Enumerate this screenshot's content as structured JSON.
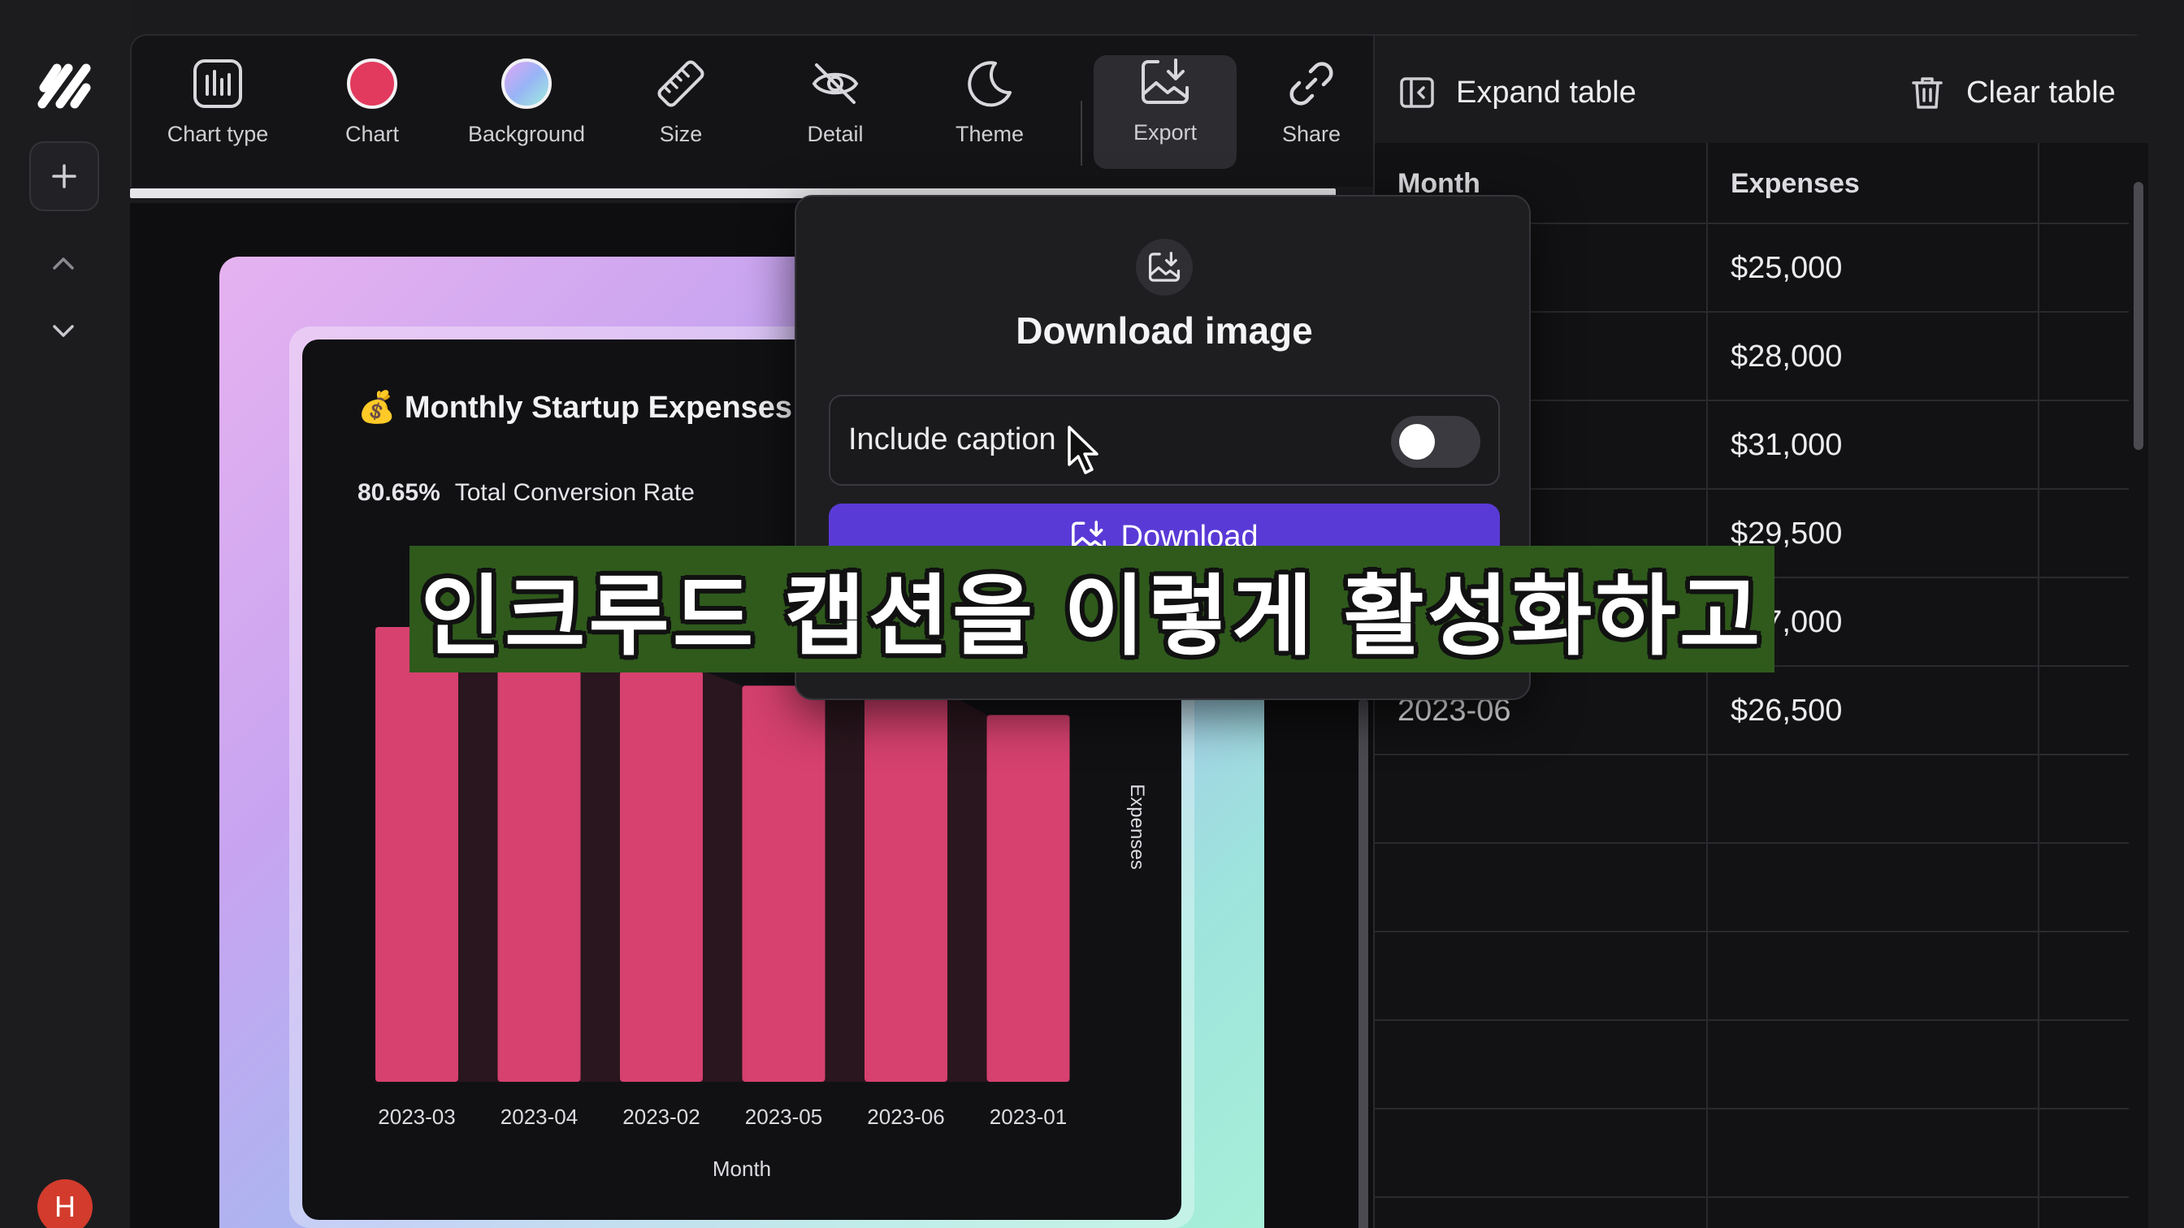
{
  "toolbar": {
    "items": [
      {
        "label": "Chart type",
        "icon": "bar-chart-icon"
      },
      {
        "label": "Chart",
        "icon": "color-dot-icon",
        "color": "#e23a5e"
      },
      {
        "label": "Background",
        "icon": "gradient-dot-icon"
      },
      {
        "label": "Size",
        "icon": "ruler-icon"
      },
      {
        "label": "Detail",
        "icon": "eye-off-icon"
      },
      {
        "label": "Theme",
        "icon": "moon-icon"
      },
      {
        "label": "Export",
        "icon": "image-download-icon",
        "active": true
      },
      {
        "label": "Share",
        "icon": "link-icon"
      }
    ]
  },
  "rail": {
    "avatar_initial": "H"
  },
  "chart_card": {
    "title": "💰 Monthly Startup Expenses",
    "kpi_value": "80.65%",
    "kpi_label": "Total Conversion Rate"
  },
  "chart_data": {
    "type": "bar",
    "categories": [
      "2023-03",
      "2023-04",
      "2023-02",
      "2023-05",
      "2023-06",
      "2023-01"
    ],
    "values": [
      31000,
      29500,
      28000,
      27000,
      26500,
      25000
    ],
    "xlabel": "Month",
    "ylabel": "Expenses",
    "bar_color": "#d6416f"
  },
  "table_panel": {
    "expand_label": "Expand table",
    "clear_label": "Clear table",
    "headers": [
      "Month",
      "Expenses",
      ""
    ],
    "rows": [
      [
        "",
        "$25,000",
        ""
      ],
      [
        "",
        "$28,000",
        ""
      ],
      [
        "",
        "$31,000",
        ""
      ],
      [
        "",
        "$29,500",
        ""
      ],
      [
        "",
        "$27,000",
        ""
      ],
      [
        "2023-06",
        "$26,500",
        ""
      ],
      [
        "",
        "",
        ""
      ],
      [
        "",
        "",
        ""
      ],
      [
        "",
        "",
        ""
      ],
      [
        "",
        "",
        ""
      ],
      [
        "",
        "",
        ""
      ],
      [
        "",
        "",
        ""
      ]
    ]
  },
  "popover": {
    "title": "Download image",
    "include_caption_label": "Include caption",
    "include_caption_on": false,
    "download_label": "Download"
  },
  "caption_overlay": {
    "text": "인크루드 캡션을 이렇게 활성화하고"
  },
  "colors": {
    "accent": "#5a3ad6",
    "bar": "#d6416f",
    "caption_bg": "#2f5a1c"
  }
}
